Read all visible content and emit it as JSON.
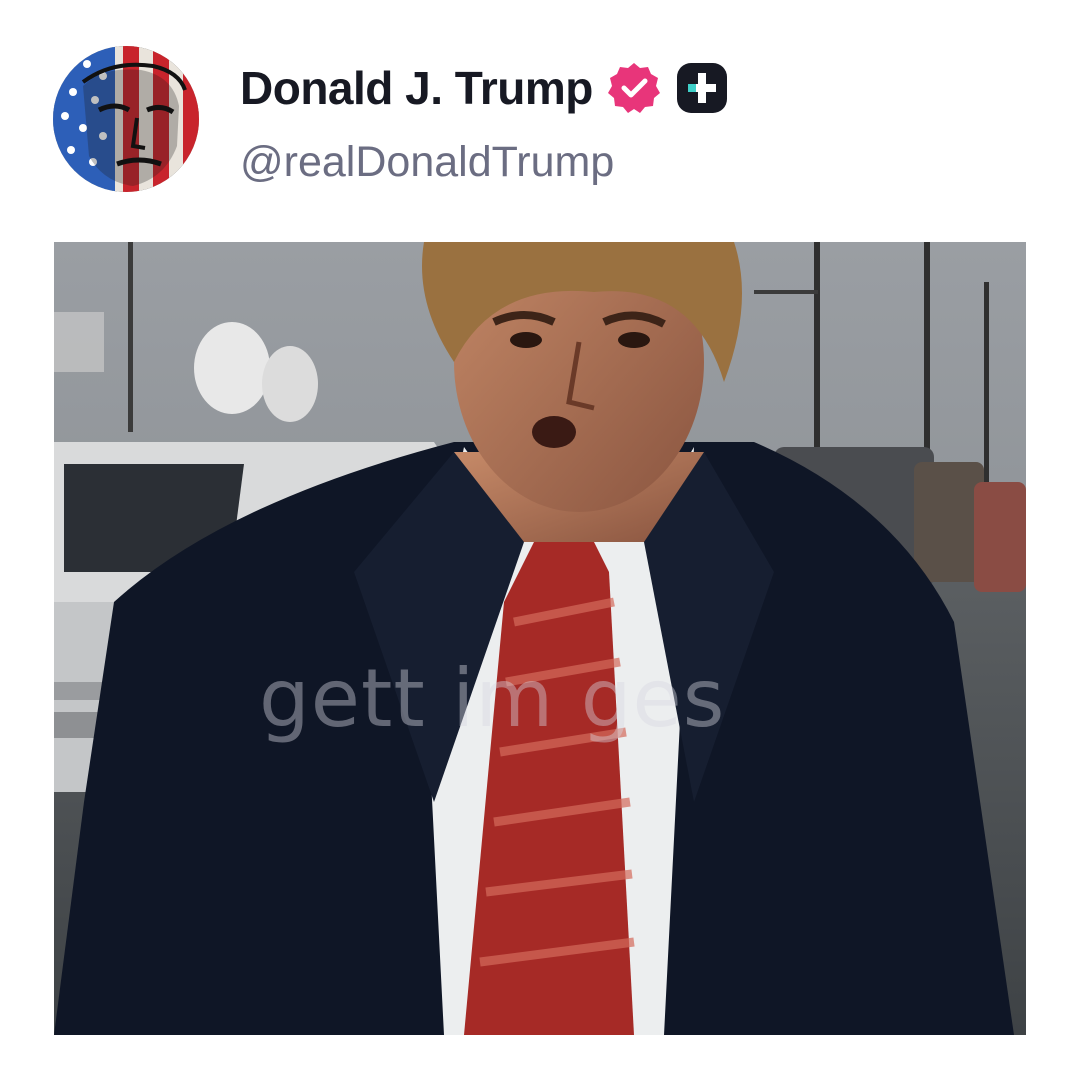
{
  "post": {
    "author": {
      "display_name": "Donald J. Trump",
      "handle": "@realDonaldTrump",
      "verified": true,
      "verified_badge_icon": "verified-check-icon",
      "platform_badge_icon": "truth-social-icon",
      "verified_color": "#e8357a",
      "platform_color": "#171923"
    },
    "media": {
      "watermark_text": "gett    im    ges",
      "type": "video-frame"
    }
  }
}
